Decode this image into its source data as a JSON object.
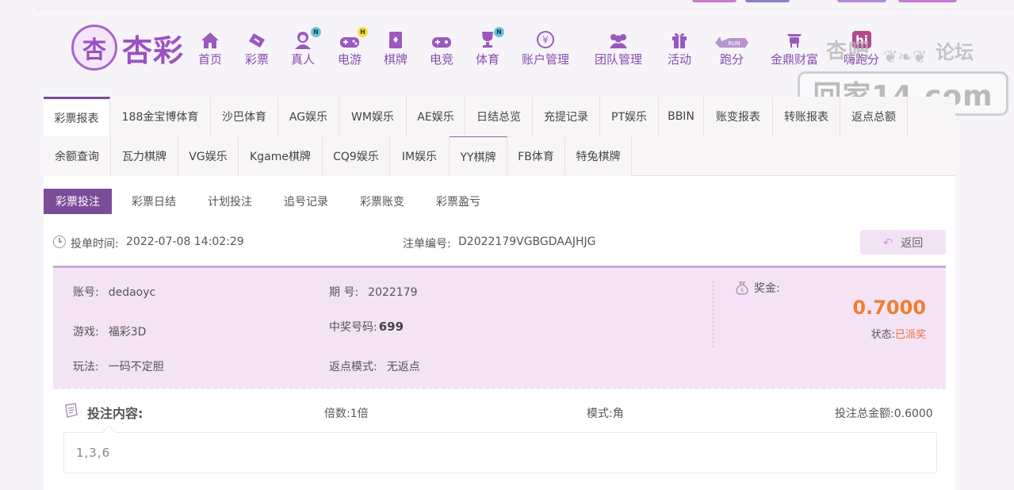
{
  "brand": {
    "logo_text": "杏彩",
    "emblem_glyph": "杏"
  },
  "nav": [
    {
      "label": "首页",
      "icon": "home-icon"
    },
    {
      "label": "彩票",
      "icon": "lottery-icon"
    },
    {
      "label": "真人",
      "icon": "live-dealer-icon",
      "badge": "N"
    },
    {
      "label": "电游",
      "icon": "gamepad-icon",
      "badge": "H"
    },
    {
      "label": "棋牌",
      "icon": "cards-icon"
    },
    {
      "label": "电竞",
      "icon": "esports-icon"
    },
    {
      "label": "体育",
      "icon": "trophy-icon",
      "badge": "N"
    },
    {
      "label": "账户管理",
      "icon": "account-icon"
    },
    {
      "label": "团队管理",
      "icon": "team-icon"
    },
    {
      "label": "活动",
      "icon": "gift-icon"
    },
    {
      "label": "跑分",
      "icon": "rhino-icon"
    },
    {
      "label": "金鼎财富",
      "icon": "wealth-icon"
    },
    {
      "label": "嗨跑分",
      "icon": "hi-icon"
    }
  ],
  "watermark": {
    "top": "杏吧",
    "right": "论坛",
    "url": "回家14.com"
  },
  "tabs_row1": [
    "彩票报表",
    "188金宝博体育",
    "沙巴体育",
    "AG娱乐",
    "WM娱乐",
    "AE娱乐",
    "日结总览",
    "充提记录",
    "PT娱乐",
    "BBIN",
    "账变报表",
    "转账报表",
    "返点总额"
  ],
  "tabs_row2": [
    "余额查询",
    "瓦力棋牌",
    "VG娱乐",
    "Kgame棋牌",
    "CQ9娱乐",
    "IM娱乐",
    "YY棋牌",
    "FB体育",
    "特兔棋牌"
  ],
  "subtabs": [
    "彩票投注",
    "彩票日结",
    "计划投注",
    "追号记录",
    "彩票账变",
    "彩票盈亏"
  ],
  "order": {
    "time_label": "投单时间:",
    "time": "2022-07-08 14:02:29",
    "id_label": "注单编号:",
    "id": "D2022179VGBGDAAJHJG",
    "back": "返回"
  },
  "detail": {
    "account_label": "账号:",
    "account": "dedaoyc",
    "game_label": "游戏:",
    "game": "福彩3D",
    "play_label": "玩法:",
    "play": "一码不定胆",
    "issue_label": "期 号:",
    "issue": "2022179",
    "win_no_label": "中奖号码:",
    "win_no": "699",
    "rebate_label": "返点模式:",
    "rebate": "无返点",
    "prize_label": "奖金:",
    "prize": "0.7000",
    "status_label": "状态:",
    "status": "已派奖"
  },
  "bet": {
    "title": "投注内容:",
    "multiple": "倍数:1倍",
    "mode": "模式:角",
    "total": "投注总金额:0.6000",
    "content": "1,3,6"
  },
  "colors": {
    "accent": "#7b4c97",
    "nav": "#8a4db0",
    "prize": "#f07e2e",
    "panel_bg": "#f3e3f5"
  }
}
